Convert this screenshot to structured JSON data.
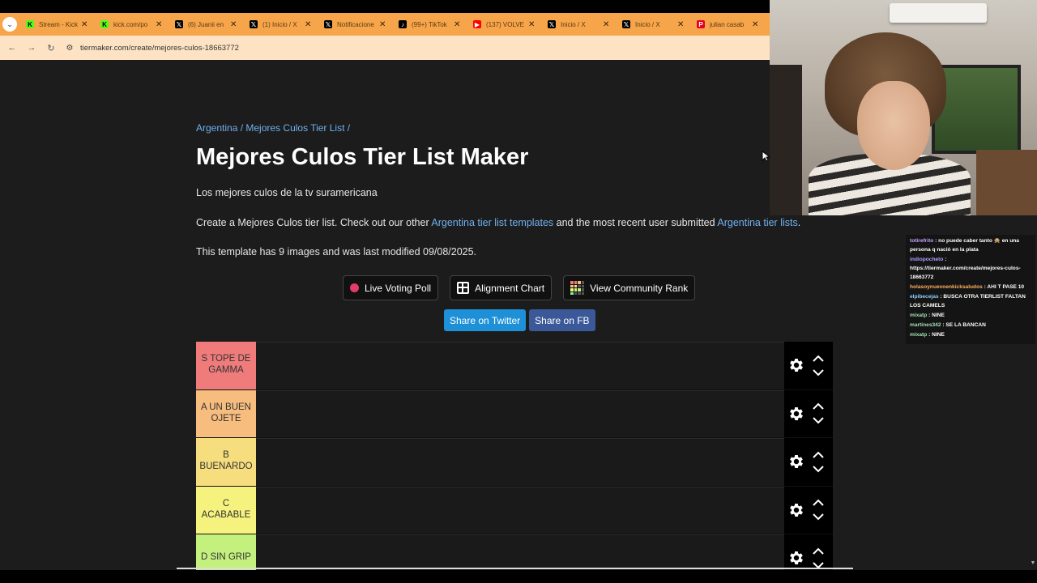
{
  "browser": {
    "tabs": [
      {
        "title": "Stream - Kick",
        "icon": "kick-icon",
        "fav": "K",
        "cls": "fav-kick"
      },
      {
        "title": "kick.com/po",
        "icon": "kick-icon",
        "fav": "K",
        "cls": "fav-kick"
      },
      {
        "title": "(6) Juanii en",
        "icon": "x-icon",
        "fav": "𝕏",
        "cls": "fav-x"
      },
      {
        "title": "(1) Inicio / X",
        "icon": "x-icon",
        "fav": "𝕏",
        "cls": "fav-x"
      },
      {
        "title": "Notificacione",
        "icon": "x-icon",
        "fav": "𝕏",
        "cls": "fav-x"
      },
      {
        "title": "(99+) TikTok",
        "icon": "tiktok-icon",
        "fav": "♪",
        "cls": "fav-tt"
      },
      {
        "title": "(137) VOLVE",
        "icon": "youtube-icon",
        "fav": "▶",
        "cls": "fav-yt"
      },
      {
        "title": "Inicio / X",
        "icon": "x-icon",
        "fav": "𝕏",
        "cls": "fav-x"
      },
      {
        "title": "Inicio / X",
        "icon": "x-icon",
        "fav": "𝕏",
        "cls": "fav-x"
      },
      {
        "title": "julian casab",
        "icon": "pinterest-icon",
        "fav": "P",
        "cls": "fav-pin"
      }
    ],
    "url": "tiermaker.com/create/mejores-culos-18663772"
  },
  "page": {
    "breadcrumb": {
      "part1": "Argentina",
      "sep1": " / ",
      "part2": "Mejores Culos Tier List",
      "sep2": " /"
    },
    "title": "Mejores Culos Tier List Maker",
    "description": "Los mejores culos de la tv suramericana",
    "create": {
      "prefix": "Create a Mejores Culos tier list. Check out our other ",
      "link1": "Argentina tier list templates",
      "middle": " and the most recent user submitted ",
      "link2": "Argentina tier lists",
      "suffix": "."
    },
    "template_info": "This template has 9 images and was last modified 09/08/2025.",
    "actions": {
      "live_voting": "Live Voting Poll",
      "alignment": "Alignment Chart",
      "community": "View Community Rank"
    },
    "share": {
      "twitter": "Share on Twitter",
      "fb": "Share on FB"
    },
    "tiers": [
      {
        "label": "S TOPE DE GAMMA",
        "color": "#f07b7b"
      },
      {
        "label": "A UN BUEN OJETE",
        "color": "#f6bd7e"
      },
      {
        "label": "B BUENARDO",
        "color": "#f6dd7e"
      },
      {
        "label": "C ACABABLE",
        "color": "#f6f27e"
      },
      {
        "label": "D SIN GRIP",
        "color": "#c4f07e"
      }
    ]
  },
  "chat": [
    {
      "user": "totirefrito",
      "color": "#c9a0ff",
      "text": " : no puede caber tanto 🙊 en una persona q nació en la plata"
    },
    {
      "user": "indiopocheto",
      "color": "#b0a0ff",
      "text": " : https://tiermaker.com/create/mejores-culos-18663772"
    },
    {
      "user": "holasoynuevoenkicksaludos",
      "color": "#ffb060",
      "text": " : AHI T PASE 10"
    },
    {
      "user": "elpibecejas",
      "color": "#8fd0ff",
      "text": " : BUSCA OTRA TIERLIST FALTAN LOS CAMELS"
    },
    {
      "user": "mixatp",
      "color": "#9fe0b0",
      "text": " : NINE"
    },
    {
      "user": "martines342",
      "color": "#9fe0b0",
      "text": " : SE LA BANCAN"
    },
    {
      "user": "mixatp",
      "color": "#9fe0b0",
      "text": " : NINE"
    }
  ]
}
